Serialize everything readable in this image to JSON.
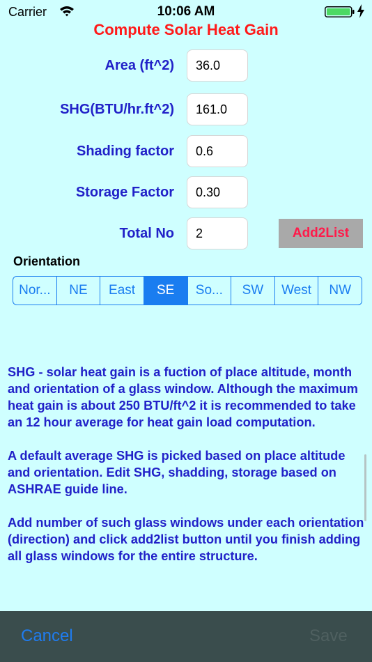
{
  "status_bar": {
    "carrier": "Carrier",
    "time": "10:06 AM"
  },
  "title": "Compute Solar Heat Gain",
  "form": {
    "area": {
      "label": "Area (ft^2)",
      "value": "36.0"
    },
    "shg": {
      "label": "SHG(BTU/hr.ft^2)",
      "value": "161.0"
    },
    "shading": {
      "label": "Shading factor",
      "value": "0.6"
    },
    "storage": {
      "label": "Storage Factor",
      "value": "0.30"
    },
    "total": {
      "label": "Total No",
      "value": "2"
    },
    "add_button": "Add2List"
  },
  "orientation": {
    "label": "Orientation",
    "segments": [
      "Nor...",
      "NE",
      "East",
      "SE",
      "So...",
      "SW",
      "West",
      "NW"
    ],
    "selected": "SE"
  },
  "help": {
    "paragraph1": "SHG - solar heat gain is a fuction of place altitude, month and orientation of a glass window. Although the maximum heat gain is about 250 BTU/ft^2 it is recommended to take an 12 hour average for heat gain load computation.",
    "paragraph2": "A default average SHG is picked based on place altitude and orientation. Edit SHG, shadding, storage based on ASHRAE guide line.",
    "paragraph3": "Add number of such glass windows under each orientation (direction) and click add2list button until you finish adding all glass windows for the entire structure."
  },
  "toolbar": {
    "cancel": "Cancel",
    "save": "Save"
  },
  "colors": {
    "background": "#cfffff",
    "title": "#ff1a1a",
    "label": "#2121c8",
    "accent": "#1a7df0",
    "battery": "#4cd964"
  }
}
